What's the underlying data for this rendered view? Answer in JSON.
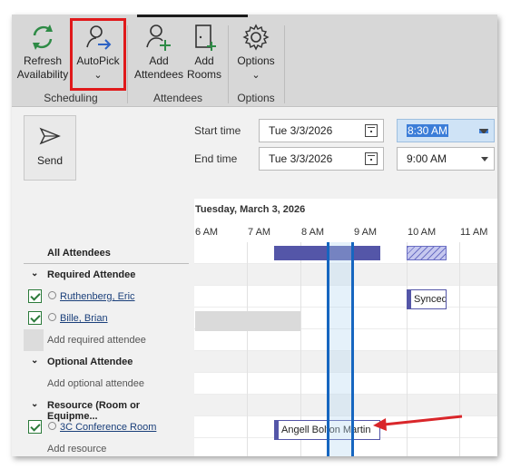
{
  "ribbon": {
    "buttons": {
      "refresh": "Refresh\nAvailability",
      "autopick": "AutoPick",
      "autopick_caret": "⌄",
      "add_attendees": "Add\nAttendees",
      "add_rooms": "Add\nRooms",
      "options": "Options",
      "options_caret": "⌄"
    },
    "groups": {
      "scheduling": "Scheduling",
      "attendees": "Attendees",
      "options": "Options"
    }
  },
  "send": {
    "label": "Send"
  },
  "times": {
    "start_label": "Start time",
    "start_date": "Tue 3/3/2026",
    "start_time": "8:30 AM",
    "end_label": "End time",
    "end_date": "Tue 3/3/2026",
    "end_time": "9:00 AM"
  },
  "grid": {
    "date_heading": "Tuesday, March 3, 2026",
    "hours": [
      "6 AM",
      "7 AM",
      "8 AM",
      "9 AM",
      "10 AM",
      "11 AM"
    ]
  },
  "attendees": {
    "all": "All Attendees",
    "required_header": "Required Attendee",
    "required": [
      "Ruthenberg, Eric",
      "Bille, Brian"
    ],
    "add_required": "Add required attendee",
    "optional_header": "Optional Attendee",
    "add_optional": "Add optional attendee",
    "resource_header": "Resource (Room or Equipme...",
    "resources": [
      "3C Conference Room"
    ],
    "add_resource": "Add resource"
  },
  "events": {
    "synced": "Synced",
    "room_booking": "Angell Bolton Martin"
  },
  "colors": {
    "busy": "#5456a8",
    "highlight": "#e0191b",
    "selection": "#1666c0",
    "arrow": "#d9262a"
  }
}
